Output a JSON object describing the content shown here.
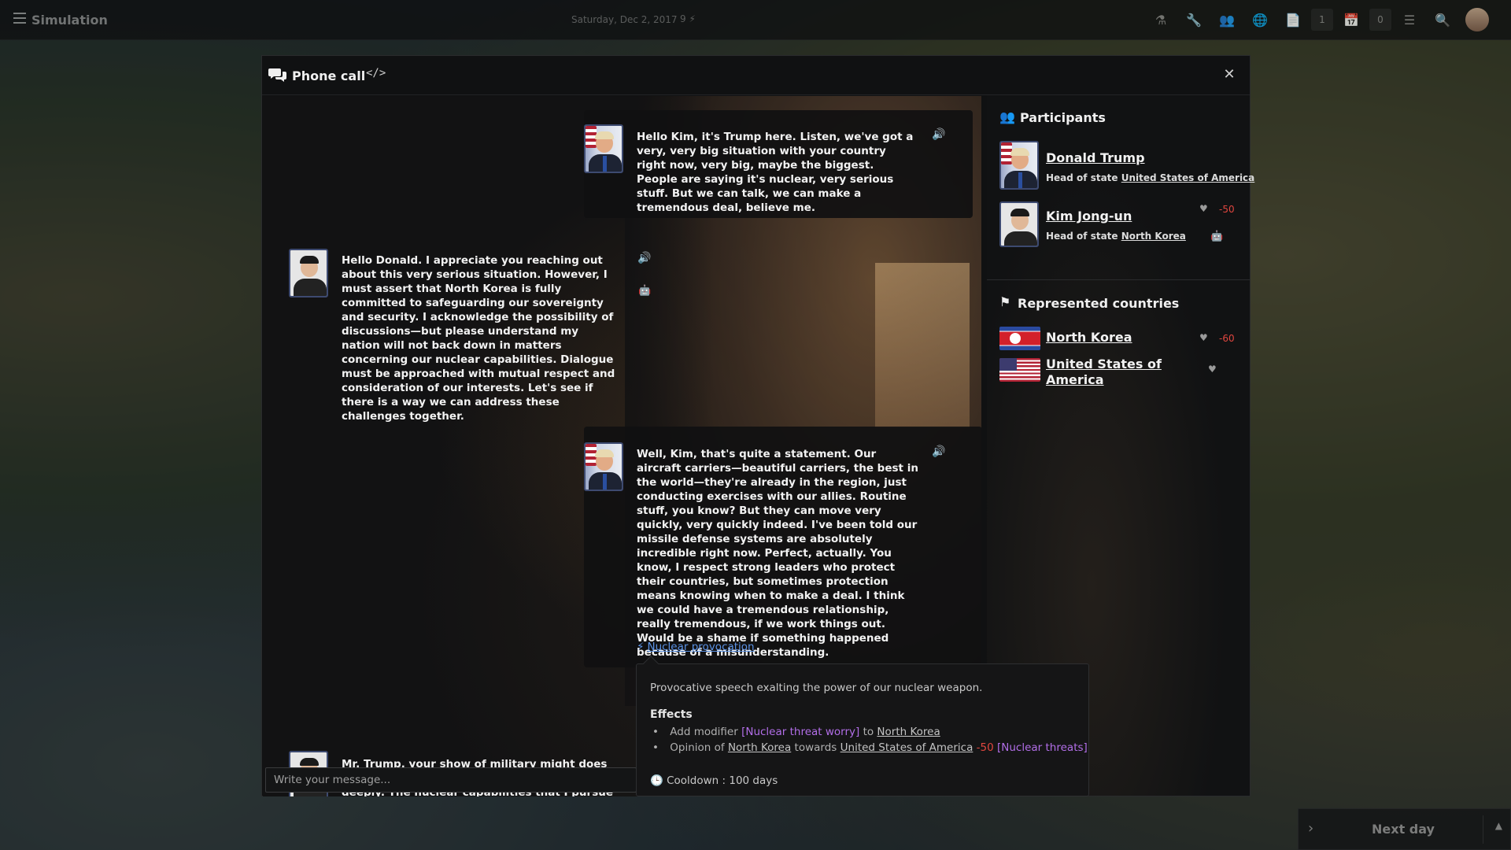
{
  "topbar": {
    "app_title": "Simulation",
    "date": "Saturday, Dec 2, 2017",
    "energy": "9",
    "count_a": "1",
    "count_b": "0"
  },
  "dialog": {
    "title": "Phone call",
    "messages": [
      {
        "speaker": "Donald Trump",
        "text": "Hello Kim, it's Trump here. Listen, we've got a very, very big situation with your country right now, very big, maybe the biggest. People are saying it's nuclear, very serious stuff. But we can talk, we can make a tremendous deal, believe me."
      },
      {
        "speaker": "Kim Jong-un",
        "text": "Hello Donald. I appreciate you reaching out about this very serious situation. However, I must assert that North Korea is fully committed to safeguarding our sovereignty and security. I acknowledge the possibility of discussions—but please understand my nation will not back down in matters concerning our nuclear capabilities. Dialogue must be approached with mutual respect and consideration of our interests. Let's see if there is a way we can address these challenges together."
      },
      {
        "speaker": "Donald Trump",
        "text": "Well, Kim, that's quite a statement. Our aircraft carriers—beautiful carriers, the best in the world—they're already in the region, just conducting exercises with our allies. Routine stuff, you know? But they can move very quickly, very quickly indeed. I've been told our missile defense systems are absolutely incredible right now. Perfect, actually. You know, I respect strong leaders who protect their countries, but sometimes protection means knowing when to make a deal. I think we could have a tremendous relationship, really tremendous, if we work things out. Would be a shame if something happened because of a misunderstanding.",
        "action": "Nuclear provocation"
      },
      {
        "speaker": "Kim Jong-un",
        "text": "Mr. Trump, your show of military might does not go unnoticed, and it raises my concerns deeply. The nuclear capabilities that I pursue are for my nation's security, but I am alarmed by the provocations that"
      }
    ],
    "input_placeholder": "Write your message..."
  },
  "tooltip": {
    "description": "Provocative speech exalting the power of our nuclear weapon.",
    "effects_title": "Effects",
    "effect1": {
      "prefix": "Add modifier ",
      "modifier": "[Nuclear threat worry]",
      "mid": " to ",
      "country": "North Korea"
    },
    "effect2": {
      "prefix": "Opinion of ",
      "country_a": "North Korea",
      "mid": " towards ",
      "country_b": "United States of America",
      "value": "-50",
      "modifier": "[Nuclear threats]"
    },
    "cooldown": "Cooldown : 100 days"
  },
  "side": {
    "participants_title": "Participants",
    "participants": [
      {
        "name": "Donald Trump",
        "role": "Head of state",
        "country": "United States of America",
        "opinion": ""
      },
      {
        "name": "Kim Jong-un",
        "role": "Head of state",
        "country": "North Korea",
        "opinion": "-50"
      }
    ],
    "countries_title": "Represented countries",
    "countries": [
      {
        "name": "North Korea",
        "opinion": "-60"
      },
      {
        "name": "United States of America",
        "opinion": ""
      }
    ]
  },
  "next_day": "Next day",
  "colors": {
    "accent_link": "#5b92e5",
    "opinion_negative": "#e0463f",
    "modifier": "#b26ee8"
  }
}
